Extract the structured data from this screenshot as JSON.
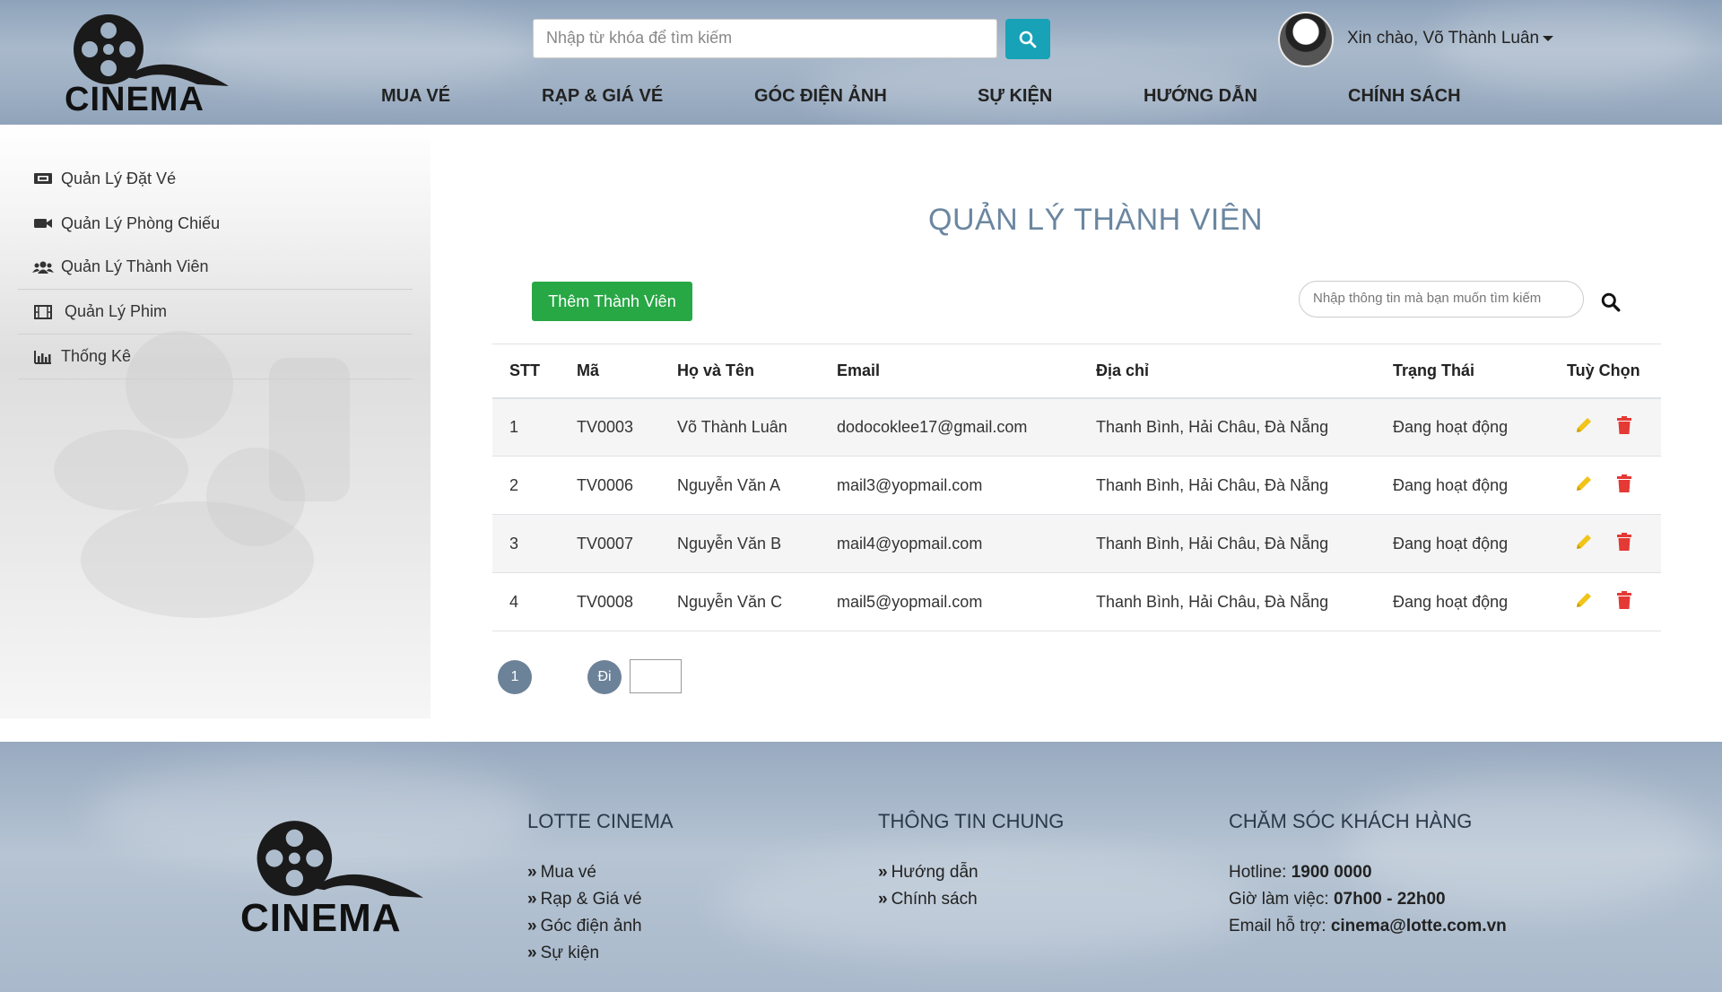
{
  "header": {
    "logo_text": "CINEMA",
    "search_placeholder": "Nhập từ khóa để tìm kiếm",
    "greeting": "Xin chào, Võ Thành Luân",
    "nav": [
      "MUA VÉ",
      "RẠP & GIÁ VÉ",
      "GÓC ĐIỆN ẢNH",
      "SỰ KIỆN",
      "HƯỚNG DẪN",
      "CHÍNH SÁCH"
    ]
  },
  "sidebar": {
    "items": [
      {
        "label": "Quản Lý Đặt Vé",
        "icon": "ticket-icon"
      },
      {
        "label": "Quản Lý Phòng Chiếu",
        "icon": "video-camera-icon"
      },
      {
        "label": "Quản Lý Thành Viên",
        "icon": "users-icon"
      },
      {
        "label": "Quản Lý Phim",
        "icon": "film-icon"
      },
      {
        "label": "Thống Kê",
        "icon": "bar-chart-icon"
      }
    ]
  },
  "main": {
    "title": "QUẢN LÝ THÀNH VIÊN",
    "add_button": "Thêm Thành Viên",
    "filter_placeholder": "Nhập thông tin mà bạn muốn tìm kiếm",
    "columns": [
      "STT",
      "Mã",
      "Họ và Tên",
      "Email",
      "Địa chỉ",
      "Trạng Thái",
      "Tuỳ Chọn"
    ],
    "rows": [
      {
        "stt": "1",
        "ma": "TV0003",
        "ten": "Võ Thành Luân",
        "email": "dodocoklee17@gmail.com",
        "diachi": "Thanh Bình, Hải Châu, Đà Nẵng",
        "trangthai": "Đang hoạt động"
      },
      {
        "stt": "2",
        "ma": "TV0006",
        "ten": "Nguyễn Văn A",
        "email": "mail3@yopmail.com",
        "diachi": "Thanh Bình, Hải Châu, Đà Nẵng",
        "trangthai": "Đang hoạt động"
      },
      {
        "stt": "3",
        "ma": "TV0007",
        "ten": "Nguyễn Văn B",
        "email": "mail4@yopmail.com",
        "diachi": "Thanh Bình, Hải Châu, Đà Nẵng",
        "trangthai": "Đang hoạt động"
      },
      {
        "stt": "4",
        "ma": "TV0008",
        "ten": "Nguyễn Văn C",
        "email": "mail5@yopmail.com",
        "diachi": "Thanh Bình, Hải Châu, Đà Nẵng",
        "trangthai": "Đang hoạt động"
      }
    ],
    "pagination": {
      "page": "1",
      "go_label": "Đi"
    },
    "colors": {
      "status": "#17a2b8",
      "edit": "#f0c419",
      "delete": "#e53935",
      "add": "#28a745"
    }
  },
  "footer": {
    "logo_text": "CINEMA",
    "col1": {
      "heading": "LOTTE CINEMA",
      "links": [
        "Mua vé",
        "Rạp & Giá vé",
        "Góc điện ảnh",
        "Sự kiện"
      ]
    },
    "col2": {
      "heading": "THÔNG TIN CHUNG",
      "links": [
        "Hướng dẫn",
        "Chính sách"
      ]
    },
    "col3": {
      "heading": "CHĂM SÓC KHÁCH HÀNG",
      "hotline_label": "Hotline: ",
      "hotline": "1900 0000",
      "hours_label": "Giờ làm việc: ",
      "hours": "07h00 - 22h00",
      "email_label": "Email hỗ trợ: ",
      "email": "cinema@lotte.com.vn"
    }
  }
}
